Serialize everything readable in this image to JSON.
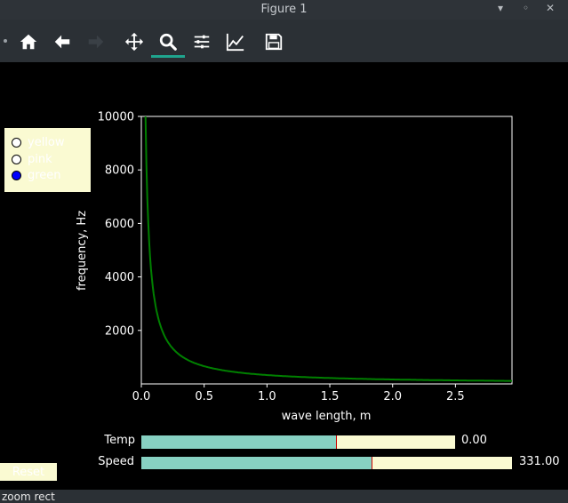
{
  "window": {
    "title": "Figure 1"
  },
  "toolbar": {
    "items": [
      {
        "name": "home-icon"
      },
      {
        "name": "back-arrow-icon"
      },
      {
        "name": "forward-arrow-icon"
      },
      {
        "name": "pan-icon"
      },
      {
        "name": "zoom-icon",
        "active": true
      },
      {
        "name": "subplots-config-icon"
      },
      {
        "name": "edit-axis-icon"
      },
      {
        "name": "save-icon"
      }
    ],
    "active_color": "#1fa58e"
  },
  "radio": {
    "options": [
      "yellow",
      "pink",
      "green"
    ],
    "selected": "green",
    "background": "#fafad2"
  },
  "chart_data": {
    "type": "line",
    "function": "frequency = speed / wave_length",
    "speed": 331.0,
    "series": [
      {
        "color": "#008000"
      }
    ],
    "x": [
      0.033,
      0.04,
      0.05,
      0.06,
      0.08,
      0.1,
      0.125,
      0.15,
      0.2,
      0.25,
      0.3,
      0.4,
      0.5,
      0.6,
      0.8,
      1.0,
      1.25,
      1.5,
      2.0,
      2.5,
      2.95
    ],
    "y": [
      10030,
      8275,
      6620,
      5517,
      4138,
      3310,
      2648,
      2207,
      1655,
      1324,
      1103,
      828,
      662,
      552,
      414,
      331,
      265,
      221,
      166,
      132,
      112
    ],
    "xlabel": "wave length, m",
    "ylabel": "frequency, Hz",
    "xlim": [
      0.0,
      2.95
    ],
    "ylim": [
      0,
      10000
    ],
    "xticks": [
      "0.0",
      "0.5",
      "1.0",
      "1.5",
      "2.0",
      "2.5"
    ],
    "yticks": [
      "2000",
      "4000",
      "6000",
      "8000",
      "10000"
    ],
    "grid": false,
    "axes_color": "#ffffff",
    "background": "#000000"
  },
  "sliders": [
    {
      "label": "Temp",
      "value_text": "0.00",
      "fill": 0.62,
      "mark": 0.62
    },
    {
      "label": "Speed",
      "value_text": "331.00",
      "fill": 0.62,
      "mark": 0.62
    }
  ],
  "reset": {
    "label": "Reset"
  },
  "status": {
    "text": "zoom rect"
  }
}
